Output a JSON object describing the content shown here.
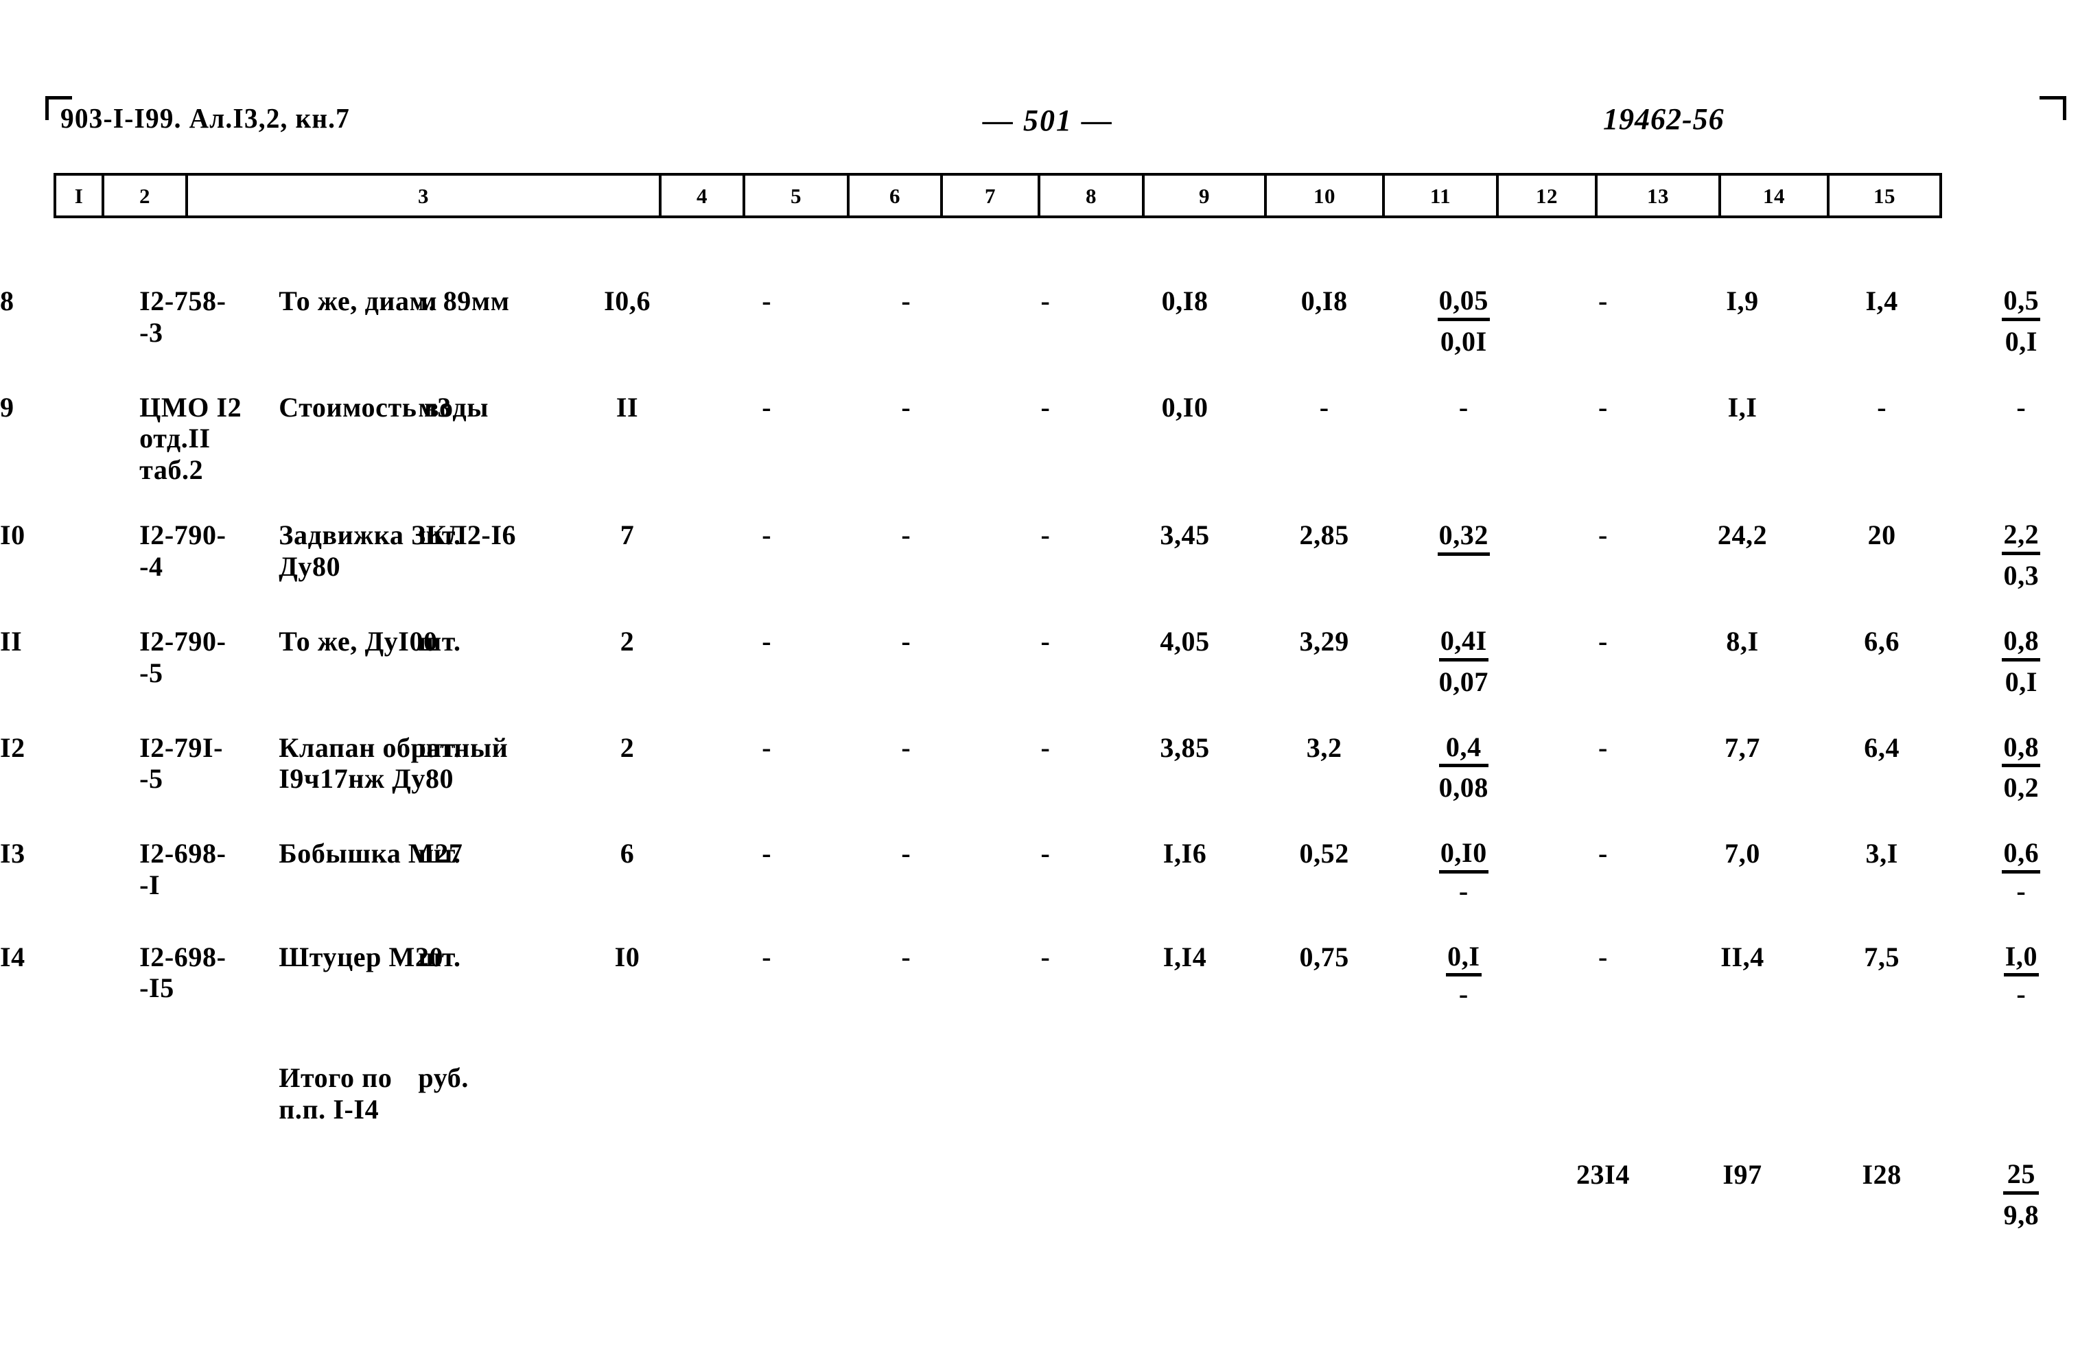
{
  "header": {
    "doc_code": "903-I-I99. Ал.I3,2, кн.7",
    "page_number": "— 501 —",
    "archive_number": "19462-56"
  },
  "column_numbers": [
    "I",
    "2",
    "3",
    "4",
    "5",
    "6",
    "7",
    "8",
    "9",
    "10",
    "11",
    "12",
    "13",
    "14",
    "15"
  ],
  "rows": [
    {
      "c1": "8",
      "c2_line1": "I2-758-",
      "c2_line2": "-3",
      "c3_line1": "То же, диам. 89мм",
      "c3_line2": "",
      "c4": "м",
      "c5": "I0,6",
      "c6": "-",
      "c7": "-",
      "c8": "-",
      "c9": "0,I8",
      "c10": "0,I8",
      "c11_num": "0,05",
      "c11_den": "0,0I",
      "c12": "-",
      "c13": "I,9",
      "c14": "I,4",
      "c15_num": "0,5",
      "c15_den": "0,I"
    },
    {
      "c1": "9",
      "c2_line1": "ЦМО I2",
      "c2_line2": "отд.II",
      "c2_line3": "таб.2",
      "c3_line1": "Стоимость воды",
      "c3_line2": "",
      "c4": "м3",
      "c5": "II",
      "c6": "-",
      "c7": "-",
      "c8": "-",
      "c9": "0,I0",
      "c10": "-",
      "c11_num": "-",
      "c11_den": "",
      "c12": "-",
      "c13": "I,I",
      "c14": "-",
      "c15_num": "-",
      "c15_den": ""
    },
    {
      "c1": "I0",
      "c2_line1": "I2-790-",
      "c2_line2": "-4",
      "c3_line1": "Задвижка ЗКЛ2-I6",
      "c3_line2": "Ду80",
      "c4": "шт.",
      "c5": "7",
      "c6": "-",
      "c7": "-",
      "c8": "-",
      "c9": "3,45",
      "c10": "2,85",
      "c11_num": "0,32",
      "c11_den": "",
      "c12": "-",
      "c13": "24,2",
      "c14": "20",
      "c15_num": "2,2",
      "c15_den": "0,3"
    },
    {
      "c1": "II",
      "c2_line1": "I2-790-",
      "c2_line2": "-5",
      "c3_line1": "То же, ДуI00",
      "c3_line2": "",
      "c4": "шт.",
      "c5": "2",
      "c6": "-",
      "c7": "-",
      "c8": "-",
      "c9": "4,05",
      "c10": "3,29",
      "c11_num": "0,4I",
      "c11_den": "0,07",
      "c12": "-",
      "c13": "8,I",
      "c14": "6,6",
      "c15_num": "0,8",
      "c15_den": "0,I"
    },
    {
      "c1": "I2",
      "c2_line1": "I2-79I-",
      "c2_line2": "-5",
      "c3_line1": "Клапан обратный",
      "c3_line2": "I9ч17нж   Ду80",
      "c4": "шт.",
      "c5": "2",
      "c6": "-",
      "c7": "-",
      "c8": "-",
      "c9": "3,85",
      "c10": "3,2",
      "c11_num": "0,4",
      "c11_den": "0,08",
      "c12": "-",
      "c13": "7,7",
      "c14": "6,4",
      "c15_num": "0,8",
      "c15_den": "0,2"
    },
    {
      "c1": "I3",
      "c2_line1": "I2-698-",
      "c2_line2": "-I",
      "c3_line1": "Бобышка М27",
      "c3_line2": "",
      "c4": "шт.",
      "c5": "6",
      "c6": "-",
      "c7": "-",
      "c8": "-",
      "c9": "I,I6",
      "c10": "0,52",
      "c11_num": "0,I0",
      "c11_den": "-",
      "c12": "-",
      "c13": "7,0",
      "c14": "3,I",
      "c15_num": "0,6",
      "c15_den": "-"
    },
    {
      "c1": "I4",
      "c2_line1": "I2-698-",
      "c2_line2": "-I5",
      "c3_line1": "Штуцер М20",
      "c3_line2": "",
      "c4": "шт.",
      "c5": "I0",
      "c6": "-",
      "c7": "-",
      "c8": "-",
      "c9": "I,I4",
      "c10": "0,75",
      "c11_num": "0,I",
      "c11_den": "-",
      "c12": "-",
      "c13": "II,4",
      "c14": "7,5",
      "c15_num": "I,0",
      "c15_den": "-"
    }
  ],
  "totals": {
    "label": "Итого по п.п. I-I4",
    "unit": "руб.",
    "c12": "23I4",
    "c13": "I97",
    "c14": "I28",
    "c15_num": "25",
    "c15_den": "9,8"
  }
}
